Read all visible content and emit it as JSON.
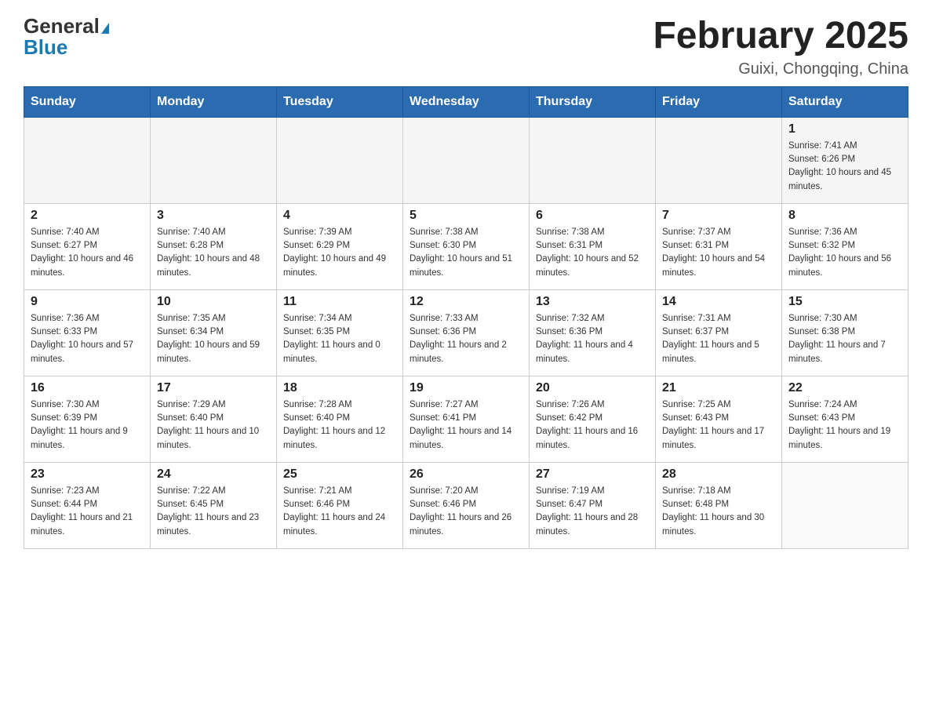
{
  "logo": {
    "general": "General",
    "blue": "Blue",
    "triangle": "▲"
  },
  "title": "February 2025",
  "subtitle": "Guixi, Chongqing, China",
  "headers": [
    "Sunday",
    "Monday",
    "Tuesday",
    "Wednesday",
    "Thursday",
    "Friday",
    "Saturday"
  ],
  "weeks": [
    [
      {
        "day": "",
        "sunrise": "",
        "sunset": "",
        "daylight": ""
      },
      {
        "day": "",
        "sunrise": "",
        "sunset": "",
        "daylight": ""
      },
      {
        "day": "",
        "sunrise": "",
        "sunset": "",
        "daylight": ""
      },
      {
        "day": "",
        "sunrise": "",
        "sunset": "",
        "daylight": ""
      },
      {
        "day": "",
        "sunrise": "",
        "sunset": "",
        "daylight": ""
      },
      {
        "day": "",
        "sunrise": "",
        "sunset": "",
        "daylight": ""
      },
      {
        "day": "1",
        "sunrise": "Sunrise: 7:41 AM",
        "sunset": "Sunset: 6:26 PM",
        "daylight": "Daylight: 10 hours and 45 minutes."
      }
    ],
    [
      {
        "day": "2",
        "sunrise": "Sunrise: 7:40 AM",
        "sunset": "Sunset: 6:27 PM",
        "daylight": "Daylight: 10 hours and 46 minutes."
      },
      {
        "day": "3",
        "sunrise": "Sunrise: 7:40 AM",
        "sunset": "Sunset: 6:28 PM",
        "daylight": "Daylight: 10 hours and 48 minutes."
      },
      {
        "day": "4",
        "sunrise": "Sunrise: 7:39 AM",
        "sunset": "Sunset: 6:29 PM",
        "daylight": "Daylight: 10 hours and 49 minutes."
      },
      {
        "day": "5",
        "sunrise": "Sunrise: 7:38 AM",
        "sunset": "Sunset: 6:30 PM",
        "daylight": "Daylight: 10 hours and 51 minutes."
      },
      {
        "day": "6",
        "sunrise": "Sunrise: 7:38 AM",
        "sunset": "Sunset: 6:31 PM",
        "daylight": "Daylight: 10 hours and 52 minutes."
      },
      {
        "day": "7",
        "sunrise": "Sunrise: 7:37 AM",
        "sunset": "Sunset: 6:31 PM",
        "daylight": "Daylight: 10 hours and 54 minutes."
      },
      {
        "day": "8",
        "sunrise": "Sunrise: 7:36 AM",
        "sunset": "Sunset: 6:32 PM",
        "daylight": "Daylight: 10 hours and 56 minutes."
      }
    ],
    [
      {
        "day": "9",
        "sunrise": "Sunrise: 7:36 AM",
        "sunset": "Sunset: 6:33 PM",
        "daylight": "Daylight: 10 hours and 57 minutes."
      },
      {
        "day": "10",
        "sunrise": "Sunrise: 7:35 AM",
        "sunset": "Sunset: 6:34 PM",
        "daylight": "Daylight: 10 hours and 59 minutes."
      },
      {
        "day": "11",
        "sunrise": "Sunrise: 7:34 AM",
        "sunset": "Sunset: 6:35 PM",
        "daylight": "Daylight: 11 hours and 0 minutes."
      },
      {
        "day": "12",
        "sunrise": "Sunrise: 7:33 AM",
        "sunset": "Sunset: 6:36 PM",
        "daylight": "Daylight: 11 hours and 2 minutes."
      },
      {
        "day": "13",
        "sunrise": "Sunrise: 7:32 AM",
        "sunset": "Sunset: 6:36 PM",
        "daylight": "Daylight: 11 hours and 4 minutes."
      },
      {
        "day": "14",
        "sunrise": "Sunrise: 7:31 AM",
        "sunset": "Sunset: 6:37 PM",
        "daylight": "Daylight: 11 hours and 5 minutes."
      },
      {
        "day": "15",
        "sunrise": "Sunrise: 7:30 AM",
        "sunset": "Sunset: 6:38 PM",
        "daylight": "Daylight: 11 hours and 7 minutes."
      }
    ],
    [
      {
        "day": "16",
        "sunrise": "Sunrise: 7:30 AM",
        "sunset": "Sunset: 6:39 PM",
        "daylight": "Daylight: 11 hours and 9 minutes."
      },
      {
        "day": "17",
        "sunrise": "Sunrise: 7:29 AM",
        "sunset": "Sunset: 6:40 PM",
        "daylight": "Daylight: 11 hours and 10 minutes."
      },
      {
        "day": "18",
        "sunrise": "Sunrise: 7:28 AM",
        "sunset": "Sunset: 6:40 PM",
        "daylight": "Daylight: 11 hours and 12 minutes."
      },
      {
        "day": "19",
        "sunrise": "Sunrise: 7:27 AM",
        "sunset": "Sunset: 6:41 PM",
        "daylight": "Daylight: 11 hours and 14 minutes."
      },
      {
        "day": "20",
        "sunrise": "Sunrise: 7:26 AM",
        "sunset": "Sunset: 6:42 PM",
        "daylight": "Daylight: 11 hours and 16 minutes."
      },
      {
        "day": "21",
        "sunrise": "Sunrise: 7:25 AM",
        "sunset": "Sunset: 6:43 PM",
        "daylight": "Daylight: 11 hours and 17 minutes."
      },
      {
        "day": "22",
        "sunrise": "Sunrise: 7:24 AM",
        "sunset": "Sunset: 6:43 PM",
        "daylight": "Daylight: 11 hours and 19 minutes."
      }
    ],
    [
      {
        "day": "23",
        "sunrise": "Sunrise: 7:23 AM",
        "sunset": "Sunset: 6:44 PM",
        "daylight": "Daylight: 11 hours and 21 minutes."
      },
      {
        "day": "24",
        "sunrise": "Sunrise: 7:22 AM",
        "sunset": "Sunset: 6:45 PM",
        "daylight": "Daylight: 11 hours and 23 minutes."
      },
      {
        "day": "25",
        "sunrise": "Sunrise: 7:21 AM",
        "sunset": "Sunset: 6:46 PM",
        "daylight": "Daylight: 11 hours and 24 minutes."
      },
      {
        "day": "26",
        "sunrise": "Sunrise: 7:20 AM",
        "sunset": "Sunset: 6:46 PM",
        "daylight": "Daylight: 11 hours and 26 minutes."
      },
      {
        "day": "27",
        "sunrise": "Sunrise: 7:19 AM",
        "sunset": "Sunset: 6:47 PM",
        "daylight": "Daylight: 11 hours and 28 minutes."
      },
      {
        "day": "28",
        "sunrise": "Sunrise: 7:18 AM",
        "sunset": "Sunset: 6:48 PM",
        "daylight": "Daylight: 11 hours and 30 minutes."
      },
      {
        "day": "",
        "sunrise": "",
        "sunset": "",
        "daylight": ""
      }
    ]
  ]
}
